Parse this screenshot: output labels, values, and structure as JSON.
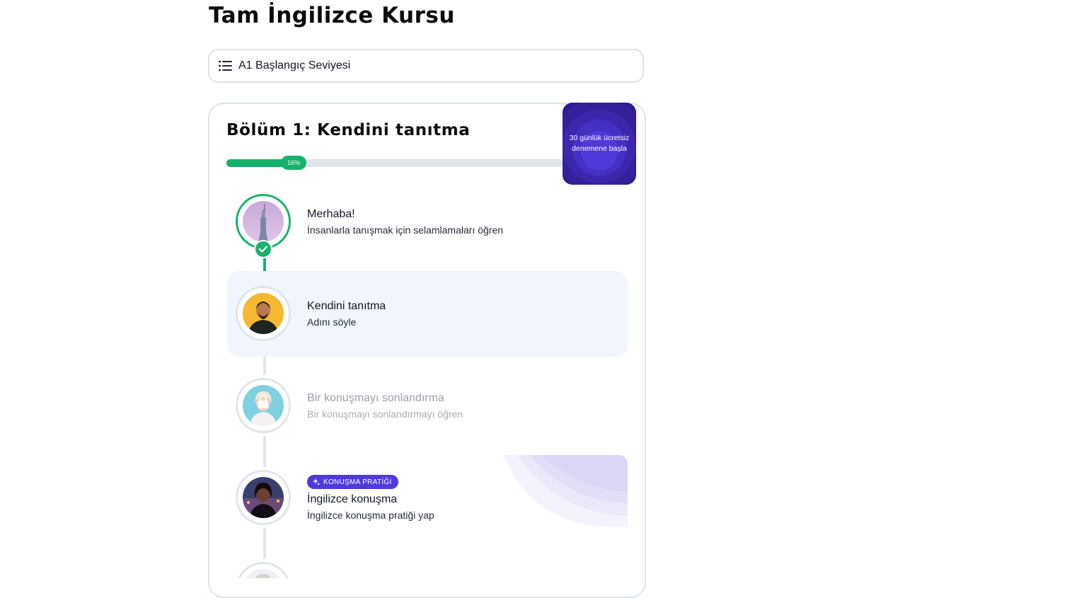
{
  "course": {
    "title": "Tam İngilizce Kursu"
  },
  "level_select": {
    "label": "A1 Başlangıç Seviyesi",
    "icon": "list-icon"
  },
  "section": {
    "title": "Bölüm 1: Kendini tanıtma",
    "progress": 16,
    "progress_label": "16%"
  },
  "trial_badge": {
    "text": "30 günlük ücretsiz denemene başla"
  },
  "lessons": [
    {
      "title": "Merhaba!",
      "subtitle": "İnsanlarla tanışmak için selamlamaları öğren",
      "status": "completed",
      "image": "statue-of-liberty"
    },
    {
      "title": "Kendini tanıtma",
      "subtitle": "Adını söyle",
      "status": "current",
      "image": "smiling-man"
    },
    {
      "title": "Bir konuşmayı sonlandırma",
      "subtitle": "Bir konuşmayı sonlandırmayı öğren",
      "status": "locked",
      "image": "waving-woman"
    },
    {
      "tag": "KONUŞMA PRATİĞİ",
      "title": "İngilizce konuşma",
      "subtitle": "İngilizce konuşma pratiği yap",
      "status": "available",
      "image": "woman-city-night"
    }
  ],
  "colors": {
    "success": "#17b26a",
    "accent": "#4f3bdc",
    "border": "#dde3ea",
    "highlight": "#f1f6fd"
  }
}
